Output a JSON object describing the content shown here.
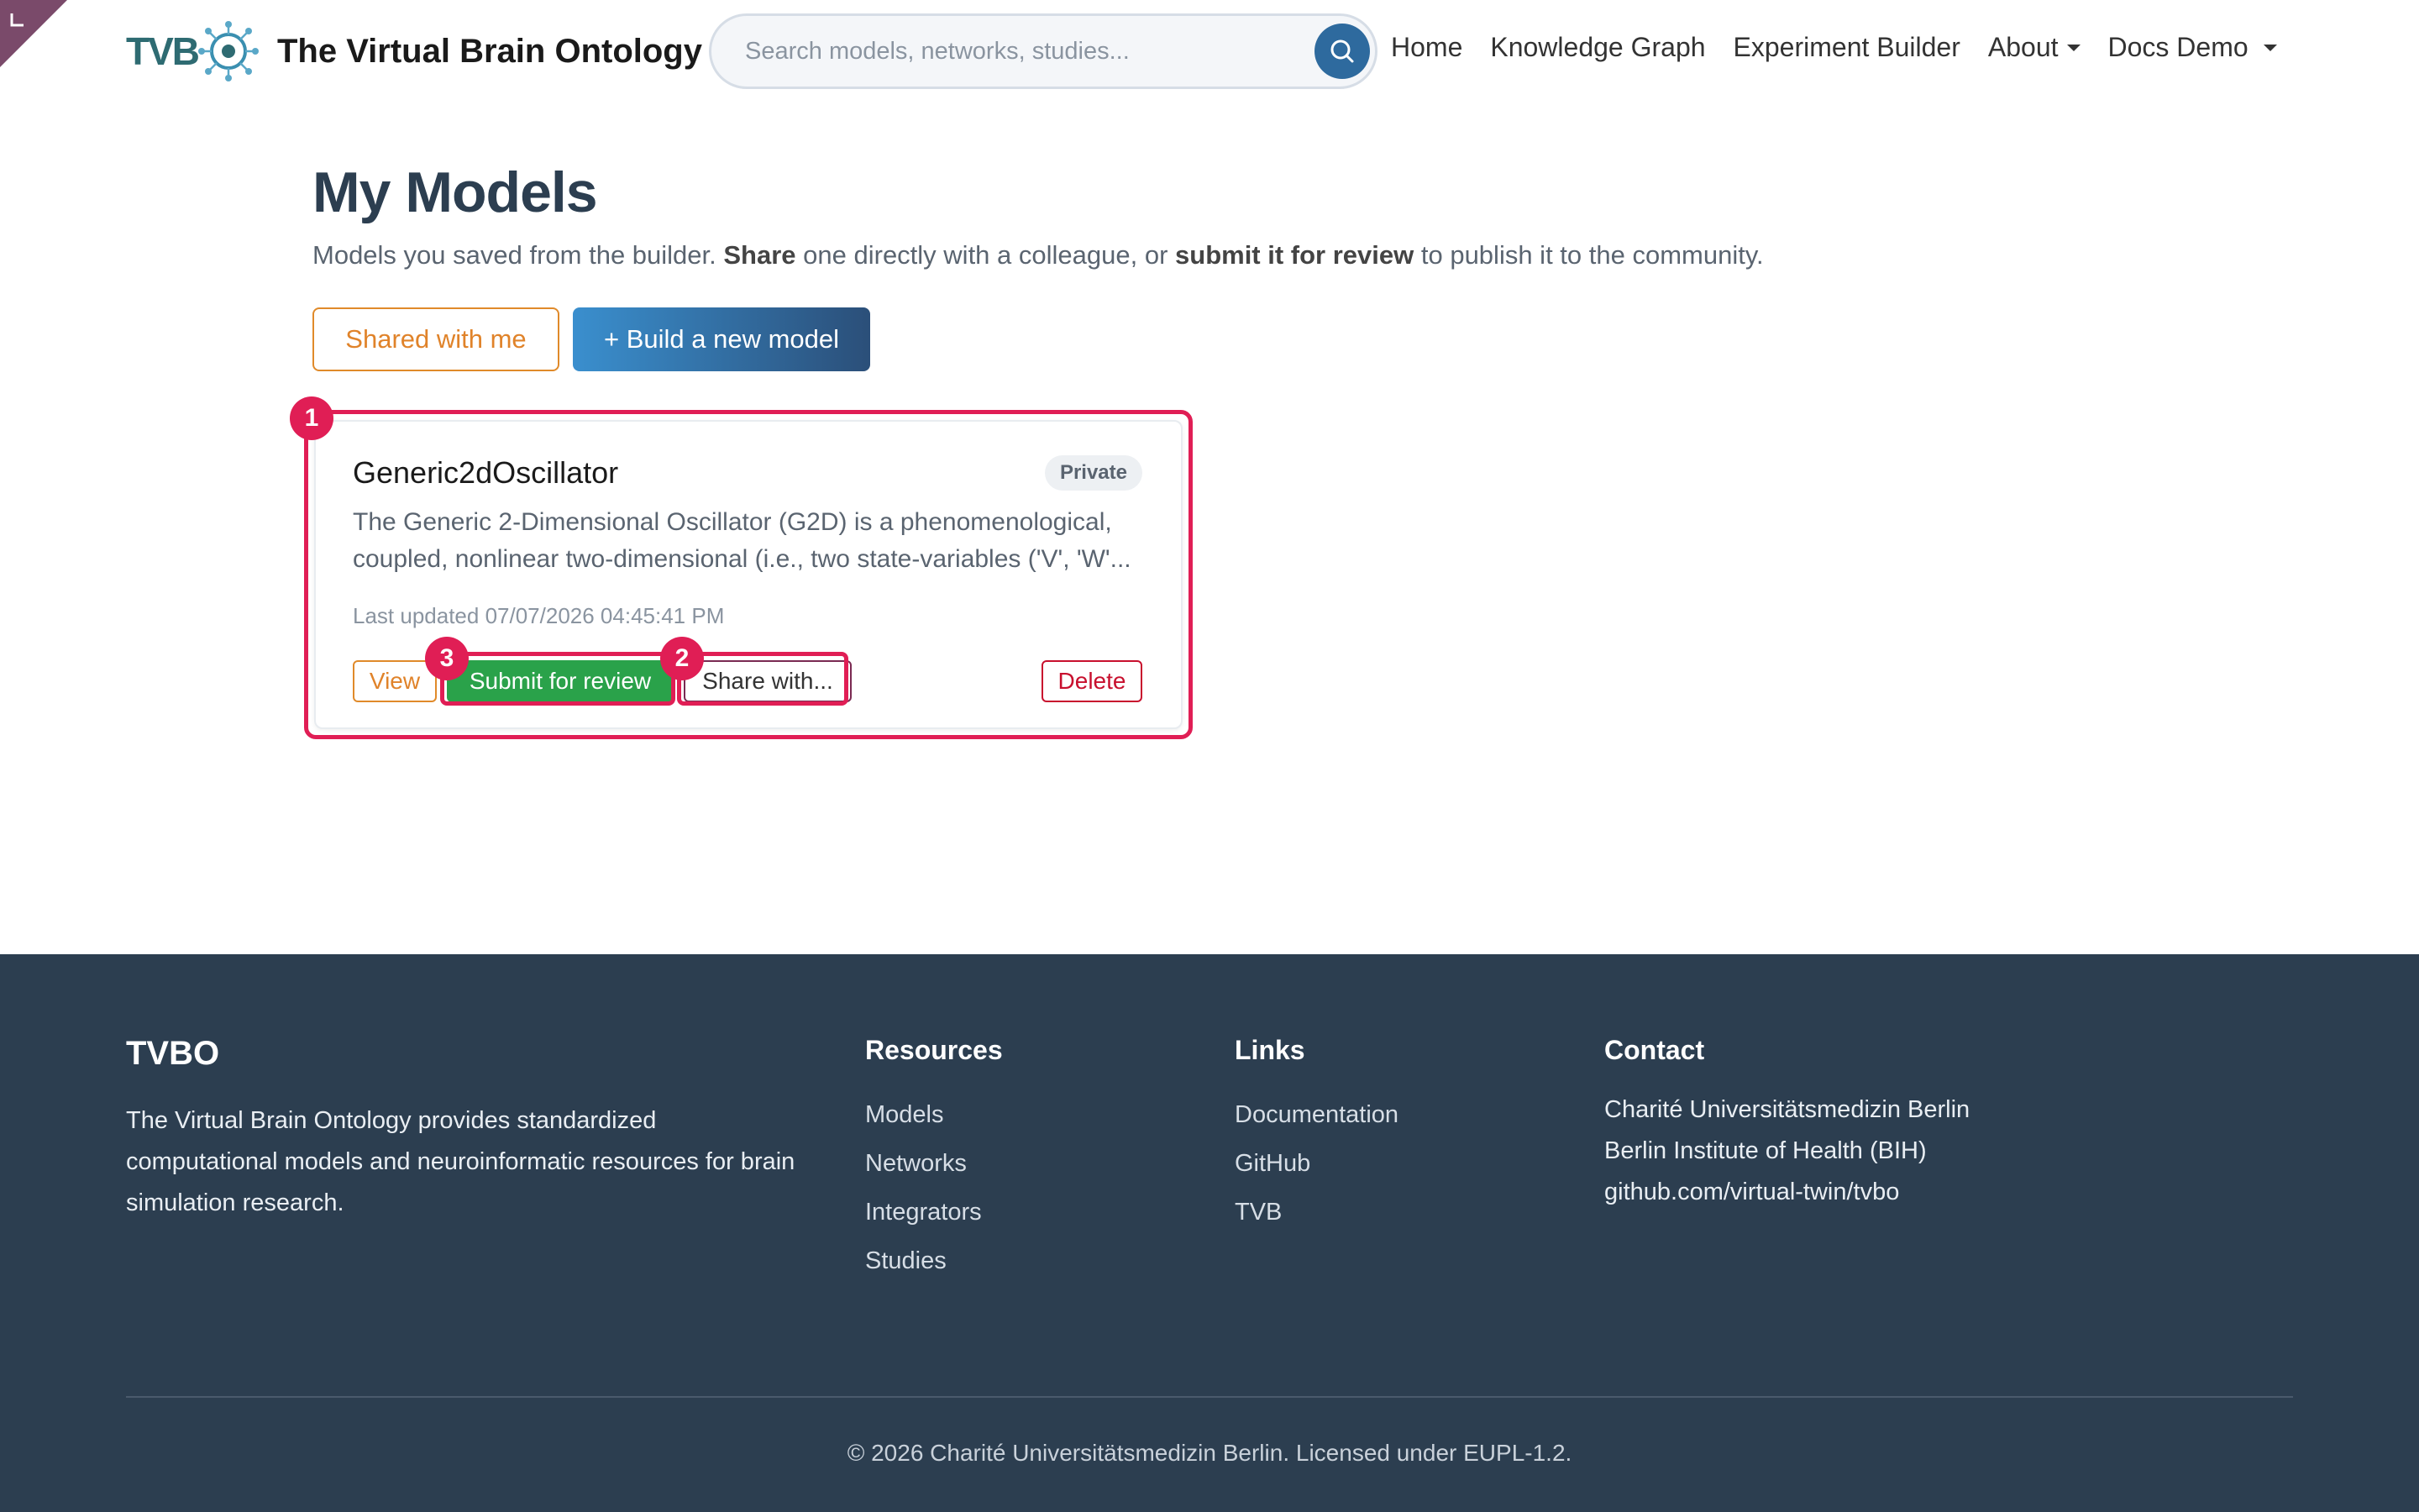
{
  "brand": {
    "logo_text": "TVB",
    "title": "The Virtual Brain Ontology"
  },
  "search": {
    "placeholder": "Search models, networks, studies..."
  },
  "nav": {
    "items": [
      {
        "label": "Home"
      },
      {
        "label": "Knowledge Graph"
      },
      {
        "label": "Experiment Builder"
      },
      {
        "label": "About"
      },
      {
        "label": "Docs Demo"
      }
    ]
  },
  "page": {
    "title": "My Models",
    "subtitle_part1": "Models you saved from the builder. ",
    "subtitle_bold1": "Share",
    "subtitle_part2": " one directly with a colleague, or ",
    "subtitle_bold2": "submit it for review",
    "subtitle_part3": " to publish it to the community.",
    "shared_button": "Shared with me",
    "build_button": "+ Build a new model"
  },
  "models": [
    {
      "name": "Generic2dOscillator",
      "visibility": "Private",
      "description": "The Generic 2-Dimensional Oscillator (G2D) is a phenomenological, coupled, nonlinear two-dimensional (i.e., two state-variables ('V', 'W'...",
      "updated": "Last updated 07/07/2026 04:45:41 PM",
      "view_label": "View",
      "submit_label": "Submit for review",
      "share_label": "Share with...",
      "delete_label": "Delete"
    }
  ],
  "annotations": {
    "marker1": "1",
    "marker2": "2",
    "marker3": "3"
  },
  "footer": {
    "brand": "TVBO",
    "about": "The Virtual Brain Ontology provides standardized computational models and neuroinformatic resources for brain simulation research.",
    "resources_title": "Resources",
    "resources": [
      "Models",
      "Networks",
      "Integrators",
      "Studies"
    ],
    "links_title": "Links",
    "links": [
      "Documentation",
      "GitHub",
      "TVB"
    ],
    "contact_title": "Contact",
    "contact": [
      "Charité Universitätsmedizin Berlin",
      "Berlin Institute of Health (BIH)",
      "github.com/virtual-twin/tvbo"
    ],
    "copyright": "© 2026 Charité Universitätsmedizin Berlin. Licensed under EUPL-1.2."
  },
  "colors": {
    "accent": "#e01e55",
    "footer_bg": "#2c3e50",
    "primary": "#2e6a9e",
    "success": "#2aa24a",
    "warning": "#e0832a",
    "danger": "#c8102e"
  }
}
